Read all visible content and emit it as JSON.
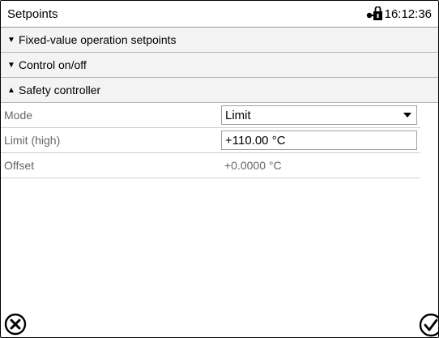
{
  "header": {
    "title": "Setpoints",
    "time": "16:12:36",
    "icons": {
      "lock": "door-lock-icon"
    }
  },
  "sections": [
    {
      "label": "Fixed-value operation setpoints",
      "expanded": false
    },
    {
      "label": "Control on/off",
      "expanded": false
    },
    {
      "label": "Safety controller",
      "expanded": true
    }
  ],
  "params": {
    "mode": {
      "label": "Mode",
      "value": "Limit"
    },
    "limit_high": {
      "label": "Limit (high)",
      "value": "+110.00 °C"
    },
    "offset": {
      "label": "Offset",
      "value": "+0.0000 °C"
    }
  },
  "footer": {
    "cancel_icon": "cancel-circle-icon",
    "confirm_icon": "checkmark-circle-icon"
  }
}
